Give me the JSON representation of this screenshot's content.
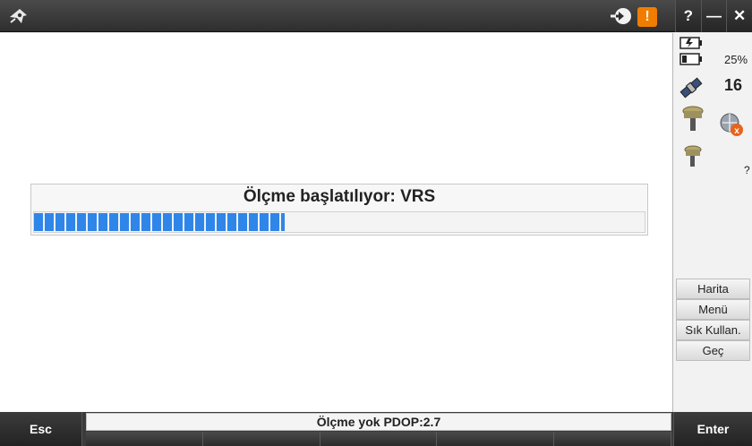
{
  "titlebar": {
    "logo_icon": "app-logo-icon",
    "login_icon": "login-icon",
    "warning_icon": "warning-icon",
    "warning_glyph": "!",
    "help_label": "?",
    "minimize_label": "—",
    "close_label": "✕",
    "warning_color": "#f07d00"
  },
  "main": {
    "progress_title": "Ölçme başlatılıyor: VRS",
    "progress_fraction": 0.41,
    "progress_color": "#2f86e8"
  },
  "side": {
    "power_icon": "power-icon",
    "battery_icon": "battery-icon",
    "battery_label": "25%",
    "satellite_icon": "satellite-icon",
    "satellite_count": "16",
    "receiver_icon": "gnss-receiver-icon",
    "radio_icon": "radio-link-icon",
    "receiver2_icon": "gnss-receiver-icon",
    "unknown_label": "?",
    "buttons": [
      {
        "label": "Harita"
      },
      {
        "label": "Menü"
      },
      {
        "label": "Sık Kullan."
      },
      {
        "label": "Geç"
      }
    ]
  },
  "bottom": {
    "esc_label": "Esc",
    "enter_label": "Enter",
    "status_text": "Ölçme yok  PDOP:2.7",
    "softkey_count": 5
  }
}
